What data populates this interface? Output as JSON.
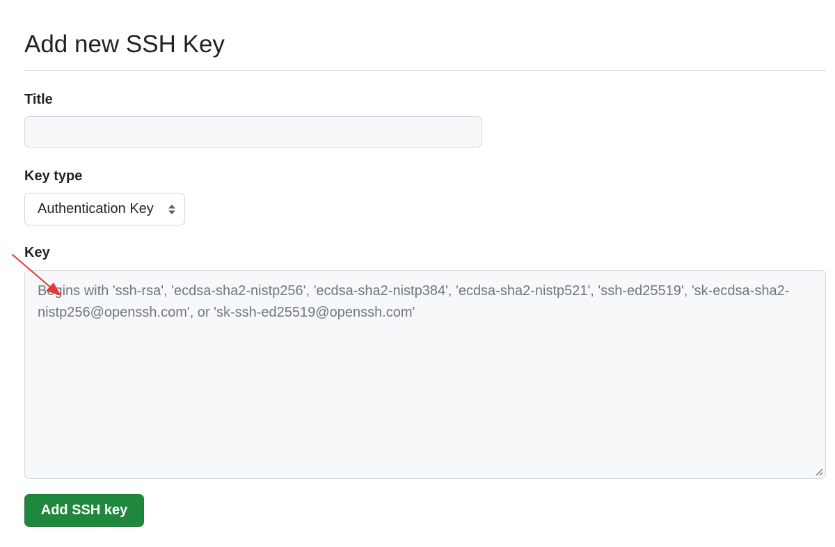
{
  "page": {
    "title": "Add new SSH Key"
  },
  "form": {
    "title_label": "Title",
    "title_value": "",
    "key_type_label": "Key type",
    "key_type_selected": "Authentication Key",
    "key_label": "Key",
    "key_placeholder": "Begins with 'ssh-rsa', 'ecdsa-sha2-nistp256', 'ecdsa-sha2-nistp384', 'ecdsa-sha2-nistp521', 'ssh-ed25519', 'sk-ecdsa-sha2-nistp256@openssh.com', or 'sk-ssh-ed25519@openssh.com'",
    "submit_label": "Add SSH key"
  },
  "icons": {
    "select_arrows": "chevron-up-down-icon",
    "resize": "resize-handle-icon",
    "annotation": "red-arrow-icon"
  },
  "colors": {
    "primary_button": "#1f883d",
    "annotation": "#e53935"
  }
}
